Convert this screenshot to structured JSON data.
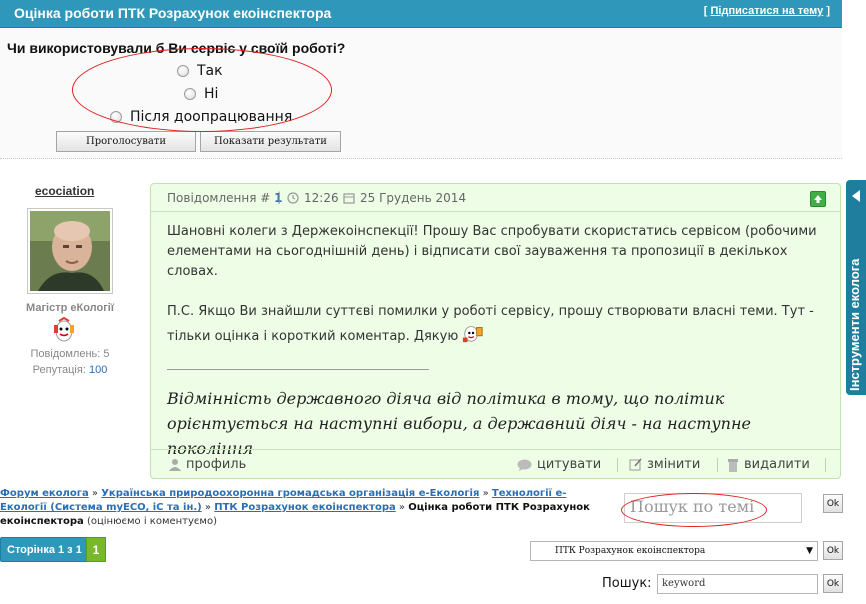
{
  "topic": {
    "title": "Оцінка роботи ПТК Розрахунок екоінспектора",
    "subscribe_open": "[ ",
    "subscribe_label": "Підписатися на тему",
    "subscribe_close": " ]"
  },
  "poll": {
    "question": "Чи використовували б Ви сервіс у своїй роботі?",
    "options": [
      "Так",
      "Ні",
      "Після доопрацювання"
    ],
    "vote_button": "Проголосувати",
    "results_button": "Показати результати"
  },
  "author": {
    "name": "ecociation",
    "rank": "Магістр еКології",
    "posts_label": "Повідомлень:",
    "posts_count": "5",
    "reputation_label": "Репутація:",
    "reputation_value": "100"
  },
  "post": {
    "header_label": "Повідомлення #",
    "number": "1",
    "separator": "|",
    "time": "12:26",
    "date": "25 Грудень 2014",
    "paragraph_1": "Шановні колеги з Держекоінспекції! Прошу Вас спробувати скористатись сервісом (робочими елементами на сьогоднішній день) і відписати свої зауваження та пропозиції в декількох словах.",
    "paragraph_2": "П.С. Якщо Ви знайшли суттєві помилки у роботі сервісу, прошу створювати власні теми. Тут - тільки оцінка і короткий коментар. Дякую",
    "signature": "Відмінність державного діяча від політика в тому, що політик орієнтується на наступні вибори, а державний діяч - на наступне покоління",
    "profile_label": "профиль",
    "quote_label": "цитувати",
    "edit_label": "змінити",
    "delete_label": "видалити"
  },
  "side_tab": {
    "label": "Інструменти екологa"
  },
  "breadcrumb": {
    "items": [
      "Форум еколога",
      "Українська природоохоронна громадська організація е-Екологія",
      "Технології е-Екології (Система myECO, iC та ін.)",
      "ПТК Розрахунок екоінспектора"
    ],
    "separator": " » ",
    "current": "Оцінка роботи ПТК Розрахунок екоінспектора",
    "suffix": " (оцінюємо і коментуємо)"
  },
  "topic_search": {
    "placeholder": "Пошук по темі",
    "ok": "Ok"
  },
  "pagination": {
    "label": "Сторінка 1 з 1",
    "current": "1"
  },
  "forum_jump": {
    "selected": "ПТК Розрахунок екоінспектора",
    "ok": "Ok"
  },
  "global_search": {
    "label": "Пошук:",
    "value": "keyword",
    "ok": "Ok"
  },
  "colors": {
    "header": "#2f97b9",
    "post_bg": "#eefde6",
    "annotation": "#e02020",
    "page_active": "#7ab82b"
  }
}
